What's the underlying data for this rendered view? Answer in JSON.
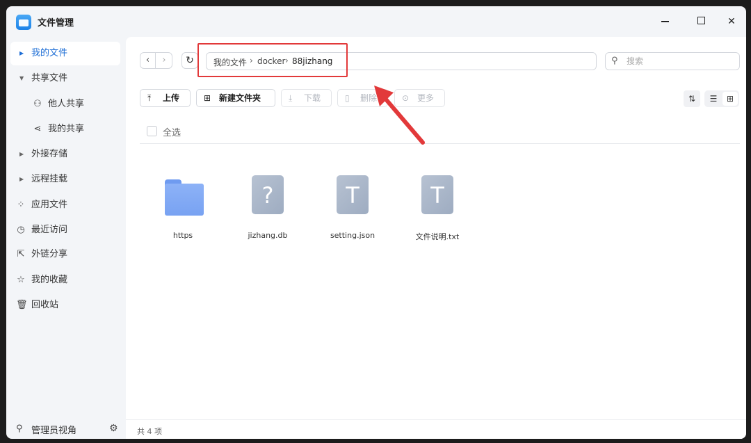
{
  "window": {
    "title": "文件管理"
  },
  "sidebar": {
    "items": [
      {
        "label": "我的文件"
      },
      {
        "label": "共享文件"
      },
      {
        "label": "他人共享"
      },
      {
        "label": "我的共享"
      },
      {
        "label": "外接存储"
      },
      {
        "label": "远程挂载"
      },
      {
        "label": "应用文件"
      },
      {
        "label": "最近访问"
      },
      {
        "label": "外链分享"
      },
      {
        "label": "我的收藏"
      },
      {
        "label": "回收站"
      }
    ],
    "footer_label": "管理员视角"
  },
  "breadcrumb": [
    "我的文件",
    "docker",
    "88jizhang"
  ],
  "search": {
    "placeholder": "搜索"
  },
  "toolbar": {
    "upload": "上传",
    "new_folder": "新建文件夹",
    "download": "下载",
    "delete": "删除",
    "more": "更多"
  },
  "select_all": "全选",
  "files": [
    {
      "name": "https",
      "type": "folder"
    },
    {
      "name": "jizhang.db",
      "type": "unknown",
      "glyph": "?"
    },
    {
      "name": "setting.json",
      "type": "text",
      "glyph": "T"
    },
    {
      "name": "文件说明.txt",
      "type": "text",
      "glyph": "T"
    }
  ],
  "status": {
    "count_label": "共 4 项"
  },
  "colors": {
    "accent": "#1f6fd6",
    "annotation": "#e2393a",
    "folder": "#7aa3f3"
  }
}
